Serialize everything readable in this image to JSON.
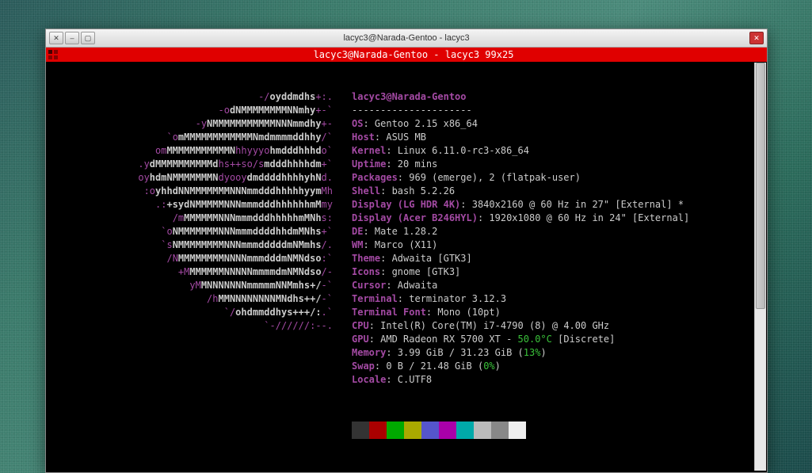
{
  "window": {
    "title": "lacyc3@Narada-Gentoo - lacyc3"
  },
  "terminator": {
    "header": "lacyc3@Narada-Gentoo - lacyc3 99x25"
  },
  "prompt": "lacyc3@Narada-Gentoo",
  "divider": "---------------------",
  "info": {
    "os_k": "OS",
    "os_v": ": Gentoo 2.15 x86_64",
    "host_k": "Host",
    "host_v": ": ASUS MB",
    "kernel_k": "Kernel",
    "kernel_v": ": Linux 6.11.0-rc3-x86_64",
    "uptime_k": "Uptime",
    "uptime_v": ": 20 mins",
    "packages_k": "Packages",
    "packages_v": ": 969 (emerge), 2 (flatpak-user)",
    "shell_k": "Shell",
    "shell_v": ": bash 5.2.26",
    "disp1_k": "Display (LG HDR 4K)",
    "disp1_v": ": 3840x2160 @ 60 Hz in 27\" [External] *",
    "disp2_k": "Display (Acer B246HYL)",
    "disp2_v": ": 1920x1080 @ 60 Hz in 24\" [External]",
    "de_k": "DE",
    "de_v": ": Mate 1.28.2",
    "wm_k": "WM",
    "wm_v": ": Marco (X11)",
    "theme_k": "Theme",
    "theme_v": ": Adwaita [GTK3]",
    "icons_k": "Icons",
    "icons_v": ": gnome [GTK3]",
    "cursor_k": "Cursor",
    "cursor_v": ": Adwaita",
    "terminal_k": "Terminal",
    "terminal_v": ": terminator 3.12.3",
    "termfont_k": "Terminal Font",
    "termfont_v": ": Mono (10pt)",
    "cpu_k": "CPU",
    "cpu_v": ": Intel(R) Core(TM) i7-4790 (8) @ 4.00 GHz",
    "gpu_k": "GPU",
    "gpu_v1": ": AMD Radeon RX 5700 XT - ",
    "gpu_temp": "50.0°C",
    "gpu_v2": " [Discrete]",
    "mem_k": "Memory",
    "mem_v1": ": 3.99 GiB / 31.23 GiB (",
    "mem_pct": "13%",
    "mem_v2": ")",
    "swap_k": "Swap",
    "swap_v1": ": 0 B / 21.48 GiB (",
    "swap_pct": "0%",
    "swap_v2": ")",
    "locale_k": "Locale",
    "locale_v": ": C.UTF8"
  },
  "logo_lines": [
    {
      "pre": "-/",
      "w": "oyddmdhs",
      "post": "+:."
    },
    {
      "pre": "-o",
      "w": "dNMMMMMMMMNNmhy",
      "post": "+-`"
    },
    {
      "pre": "-y",
      "w": "NMMMMMMMMMMMNNNmmdhy",
      "post": "+-"
    },
    {
      "pre": "`o",
      "w": "mMMMMMMMMMMMMNmdmmmmddhhy",
      "post": "/`"
    },
    {
      "pre": "om",
      "w": "MMMMMMMMMMMN",
      "mid": "hhyyyo",
      "w2": "hmdddhhhd",
      "post": "o`"
    },
    {
      "pre": ".y",
      "w": "dMMMMMMMMMMd",
      "mid": "hs++so/s",
      "w2": "mdddhhhhdm",
      "post": "+`"
    },
    {
      "pre": "oy",
      "w": "hdmNMMMMMMMN",
      "mid": "dyooy",
      "w2": "dmddddhhhhyhN",
      "post": "d."
    },
    {
      "pre": ":o",
      "w": "yhhdNNMMMMMMMNNNmmdddhhhhhyym",
      "post": "Mh"
    },
    {
      "pre": ".:",
      "w": "+sydNMMMMMNNNmmmdddhhhhhhmM",
      "post": "my"
    },
    {
      "pre": "/m",
      "w": "MMMMMMNNNmmmdddhhhhhmMNh",
      "post": "s:"
    },
    {
      "pre": "`o",
      "w": "NMMMMMMMNNNmmmddddhhdmMNhs",
      "post": "+`"
    },
    {
      "pre": "`s",
      "w": "NMMMMMMMMNNNmmmdddddmNMmhs",
      "post": "/."
    },
    {
      "pre": "/N",
      "w": "MMMMMMMMNNNNmmmdddmNMNdso",
      "post": ":`"
    },
    {
      "pre": "+M",
      "w": "MMMMMMNNNNNmmmmdmNMNdso",
      "post": "/-"
    },
    {
      "pre": "yM",
      "w": "MNNNNNNNmmmmmNNMmhs+/",
      "post": "-`"
    },
    {
      "pre": "/h",
      "w": "MMNNNNNNNNMNdhs++/",
      "post": "-`"
    },
    {
      "pre": "`/",
      "w": "ohdmmddhys+++/:",
      "post": ".`"
    },
    {
      "pre": "`-//////:--.",
      "w": "",
      "post": ""
    }
  ],
  "palette": [
    "#000000",
    "#aa0000",
    "#00aa00",
    "#aaaa00",
    "#5555ff",
    "#aa00aa",
    "#00aaaa",
    "#aaaaaa",
    "#555555",
    "#ff5555",
    "#55ff55",
    "#ffff55",
    "#7777ff",
    "#ff55ff",
    "#55ffff",
    "#ffffff"
  ]
}
